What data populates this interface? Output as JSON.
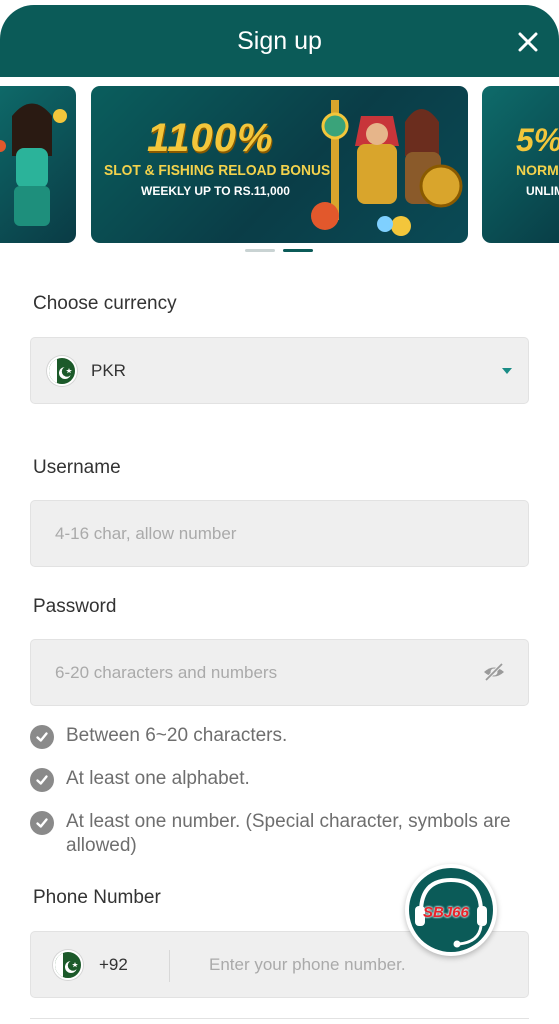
{
  "header": {
    "title": "Sign up",
    "close_icon": "close-icon"
  },
  "banners": {
    "main": {
      "headline": "1100%",
      "subtitle": "SLOT & FISHING RELOAD BONUS",
      "detail": "WEEKLY UP TO RS.11,000"
    },
    "next": {
      "headline": "5%",
      "subtitle": "NORMA",
      "detail": "UNLIM"
    },
    "active_index": 1,
    "dot_count": 2
  },
  "currency": {
    "label": "Choose currency",
    "value": "PKR",
    "flag_icon": "pakistan-flag-icon"
  },
  "username": {
    "label": "Username",
    "placeholder": "4-16 char, allow number"
  },
  "password": {
    "label": "Password",
    "placeholder": "6-20 characters and numbers",
    "toggle_icon": "eye-slash-icon",
    "rules": [
      "Between 6~20 characters.",
      "At least one alphabet.",
      "At least one number. (Special character, symbols are allowed)"
    ]
  },
  "phone": {
    "label": "Phone Number",
    "country_code": "+92",
    "placeholder": "Enter your phone number."
  },
  "support": {
    "logo": "SBJ66",
    "icon": "headset-icon"
  },
  "colors": {
    "brand": "#0b5b58",
    "accent": "#1a8c86",
    "field_bg": "#efefef",
    "check_bg": "#8a8a8a"
  }
}
